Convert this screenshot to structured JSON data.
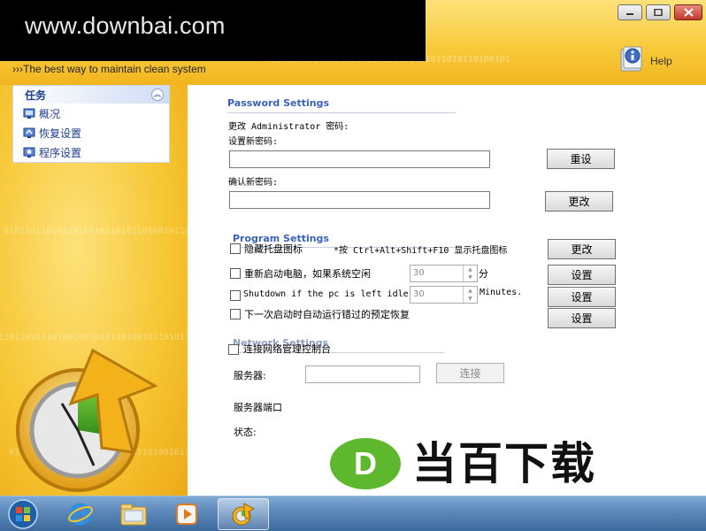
{
  "header": {
    "watermark_text": "www.downbai.com",
    "tagline": "›››The best way to maintain clean system",
    "binary_text": "0101101101011010010110101101001011010110100101",
    "help_label": "Help"
  },
  "window_controls": [
    "minimize-icon",
    "maximize-icon",
    "close-icon"
  ],
  "sidebar": {
    "panel_title": "任务",
    "items": [
      {
        "label": "概况",
        "icon": "overview-icon"
      },
      {
        "label": "恢复设置",
        "icon": "restore-settings-icon"
      },
      {
        "label": "程序设置",
        "icon": "program-settings-icon"
      }
    ]
  },
  "password": {
    "section_title": "Password Settings",
    "change_label": "更改 Administrator 密码:",
    "new_label": "设置新密码:",
    "confirm_label": "确认新密码:",
    "reset_button": "重设",
    "change_button": "更改"
  },
  "program": {
    "section_title": "Program Settings",
    "hide_tray_label": "隐藏托盘图标",
    "hide_tray_hint": "*按 Ctrl+Alt+Shift+F10 显示托盘图标",
    "hide_tray_button": "更改",
    "restart_label": "重新启动电脑，如果系统空闲",
    "restart_value": "30",
    "restart_unit": "分",
    "restart_button": "设置",
    "shutdown_label": "Shutdown if the pc is left idle",
    "shutdown_value": "30",
    "shutdown_unit": "Minutes.",
    "shutdown_button": "设置",
    "missed_label": "下一次启动时自动运行错过的预定恢复",
    "missed_button": "设置"
  },
  "network": {
    "section_title": "Network Settings",
    "connect_label": "连接网络管理控制台",
    "server_label": "服务器:",
    "connect_button": "连接",
    "port_label": "服务器端口",
    "status_label": "状态:"
  },
  "brand": {
    "letter": "D",
    "text": "当百下载"
  },
  "taskbar": {
    "items": [
      "start-orb-icon",
      "internet-explorer-icon",
      "file-explorer-icon",
      "media-player-icon",
      "app-icon"
    ]
  },
  "colors": {
    "accent_blue": "#3a62b8",
    "header_yellow": "#f8cb3c",
    "brand_green": "#5db82e"
  }
}
